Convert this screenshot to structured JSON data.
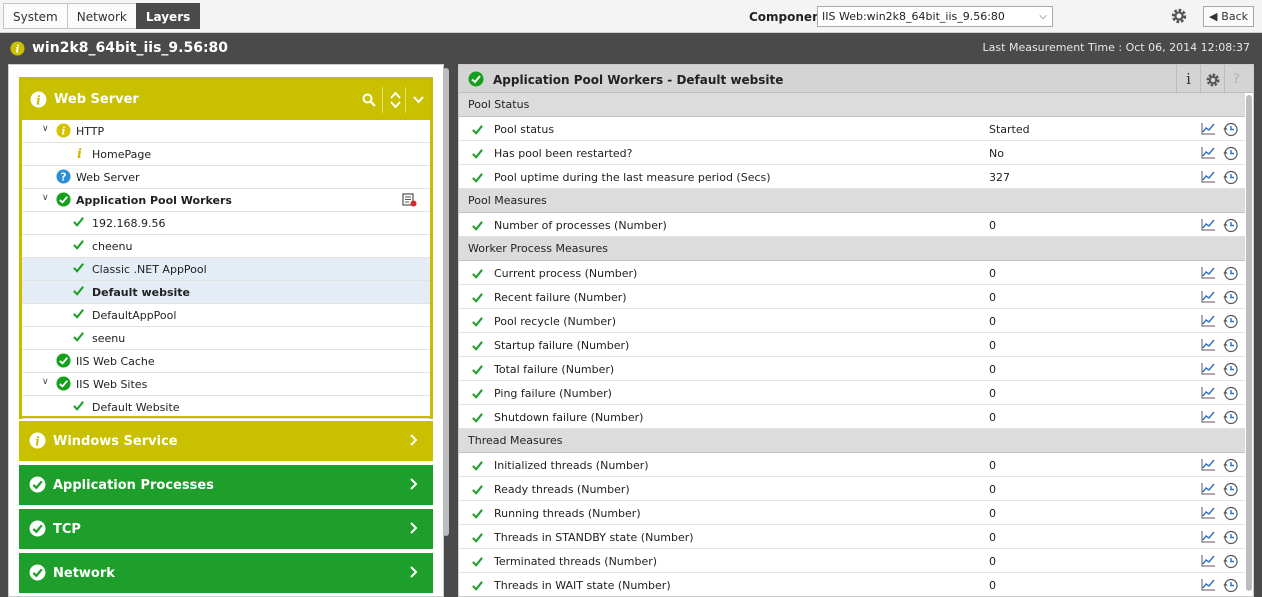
{
  "tabs": [
    {
      "label": "System",
      "active": false
    },
    {
      "label": "Network",
      "active": false
    },
    {
      "label": "Layers",
      "active": true
    }
  ],
  "component": {
    "label": "Component",
    "value": "IIS Web:win2k8_64bit_iis_9.56:80"
  },
  "back_label": "Back",
  "host": {
    "name": "win2k8_64bit_iis_9.56:80",
    "last_measurement": "Last Measurement Time : Oct 06, 2014 12:08:37"
  },
  "colors": {
    "accent_yellow": "#c9c100",
    "accent_green": "#1e9e2b",
    "ok_green": "#14a01d",
    "info_blue": "#2a8fd6"
  },
  "left": {
    "open_group": {
      "title": "Web Server",
      "tree": [
        {
          "label": "HTTP",
          "icon": "info-icon",
          "level": 1,
          "expander": true
        },
        {
          "label": "HomePage",
          "icon": "info-small-icon",
          "level": 2
        },
        {
          "label": "Web Server",
          "icon": "question-icon",
          "level": 1
        },
        {
          "label": "Application Pool Workers",
          "icon": "ok-circle-icon",
          "level": 1,
          "expander": true,
          "bold": true,
          "extra": "report-icon"
        },
        {
          "label": "192.168.9.56",
          "icon": "check-icon",
          "level": 2
        },
        {
          "label": "cheenu",
          "icon": "check-icon",
          "level": 2
        },
        {
          "label": "Classic .NET AppPool",
          "icon": "check-icon",
          "level": 2,
          "selected": true
        },
        {
          "label": "Default website",
          "icon": "check-icon",
          "level": 2,
          "selected": true,
          "bold": true
        },
        {
          "label": "DefaultAppPool",
          "icon": "check-icon",
          "level": 2
        },
        {
          "label": "seenu",
          "icon": "check-icon",
          "level": 2
        },
        {
          "label": "IIS Web Cache",
          "icon": "ok-circle-icon",
          "level": 1
        },
        {
          "label": "IIS Web Sites",
          "icon": "ok-circle-icon",
          "level": 1,
          "expander": true
        },
        {
          "label": "Default Website",
          "icon": "check-icon",
          "level": 2
        }
      ]
    },
    "closed_groups": [
      {
        "title": "Windows Service",
        "status": "info"
      },
      {
        "title": "Application Processes",
        "status": "ok"
      },
      {
        "title": "TCP",
        "status": "ok"
      },
      {
        "title": "Network",
        "status": "ok"
      }
    ]
  },
  "right": {
    "title": "Application Pool Workers - Default website",
    "sections": [
      {
        "title": "Pool Status",
        "rows": [
          {
            "name": "Pool status",
            "value": "Started"
          },
          {
            "name": "Has pool been restarted?",
            "value": "No"
          },
          {
            "name": "Pool uptime during the last measure period (Secs)",
            "value": "327"
          }
        ]
      },
      {
        "title": "Pool Measures",
        "rows": [
          {
            "name": "Number of processes (Number)",
            "value": "0"
          }
        ]
      },
      {
        "title": "Worker Process Measures",
        "rows": [
          {
            "name": "Current process (Number)",
            "value": "0"
          },
          {
            "name": "Recent failure (Number)",
            "value": "0"
          },
          {
            "name": "Pool recycle (Number)",
            "value": "0"
          },
          {
            "name": "Startup failure (Number)",
            "value": "0"
          },
          {
            "name": "Total failure (Number)",
            "value": "0"
          },
          {
            "name": "Ping failure (Number)",
            "value": "0"
          },
          {
            "name": "Shutdown failure (Number)",
            "value": "0"
          }
        ]
      },
      {
        "title": "Thread Measures",
        "rows": [
          {
            "name": "Initialized threads (Number)",
            "value": "0"
          },
          {
            "name": "Ready threads (Number)",
            "value": "0"
          },
          {
            "name": "Running threads (Number)",
            "value": "0"
          },
          {
            "name": "Threads in STANDBY state (Number)",
            "value": "0"
          },
          {
            "name": "Terminated threads (Number)",
            "value": "0"
          },
          {
            "name": "Threads in WAIT state (Number)",
            "value": "0"
          }
        ]
      }
    ]
  }
}
